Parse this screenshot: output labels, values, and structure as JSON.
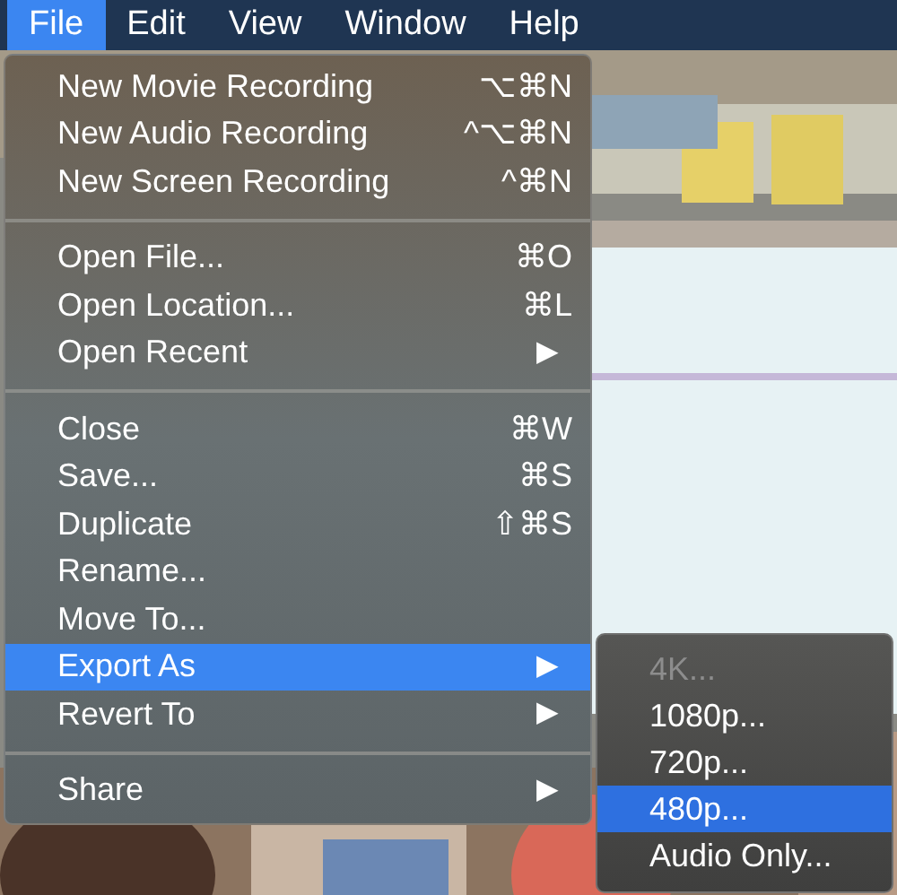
{
  "menubar": [
    {
      "label": "File",
      "selected": true
    },
    {
      "label": "Edit",
      "selected": false
    },
    {
      "label": "View",
      "selected": false
    },
    {
      "label": "Window",
      "selected": false
    },
    {
      "label": "Help",
      "selected": false
    }
  ],
  "menu": [
    {
      "kind": "item",
      "label": "New Movie Recording",
      "shortcut": "⌥⌘N",
      "selected": false
    },
    {
      "kind": "item",
      "label": "New Audio Recording",
      "shortcut": "^⌥⌘N",
      "selected": false
    },
    {
      "kind": "item",
      "label": "New Screen Recording",
      "shortcut": "^⌘N",
      "selected": false
    },
    {
      "kind": "separator"
    },
    {
      "kind": "item",
      "label": "Open File...",
      "shortcut": "⌘O",
      "selected": false
    },
    {
      "kind": "item",
      "label": "Open Location...",
      "shortcut": "⌘L",
      "selected": false
    },
    {
      "kind": "submenu",
      "label": "Open Recent",
      "arrow": "▶",
      "selected": false
    },
    {
      "kind": "separator"
    },
    {
      "kind": "item",
      "label": "Close",
      "shortcut": "⌘W",
      "selected": false
    },
    {
      "kind": "item",
      "label": "Save...",
      "shortcut": "⌘S",
      "selected": false
    },
    {
      "kind": "item",
      "label": "Duplicate",
      "shortcut": "⇧⌘S",
      "selected": false
    },
    {
      "kind": "item",
      "label": "Rename...",
      "selected": false
    },
    {
      "kind": "item",
      "label": "Move To...",
      "selected": false
    },
    {
      "kind": "submenu",
      "label": "Export As",
      "arrow": "▶",
      "selected": true
    },
    {
      "kind": "submenu",
      "label": "Revert To",
      "arrow": "▶",
      "selected": false
    },
    {
      "kind": "separator"
    },
    {
      "kind": "submenu",
      "label": "Share",
      "arrow": "▶",
      "selected": false
    }
  ],
  "submenu": [
    {
      "label": "4K...",
      "disabled": true,
      "selected": false
    },
    {
      "label": "1080p...",
      "disabled": false,
      "selected": false
    },
    {
      "label": "720p...",
      "disabled": false,
      "selected": false
    },
    {
      "label": "480p...",
      "disabled": false,
      "selected": true
    },
    {
      "label": "Audio Only...",
      "disabled": false,
      "selected": false
    }
  ]
}
